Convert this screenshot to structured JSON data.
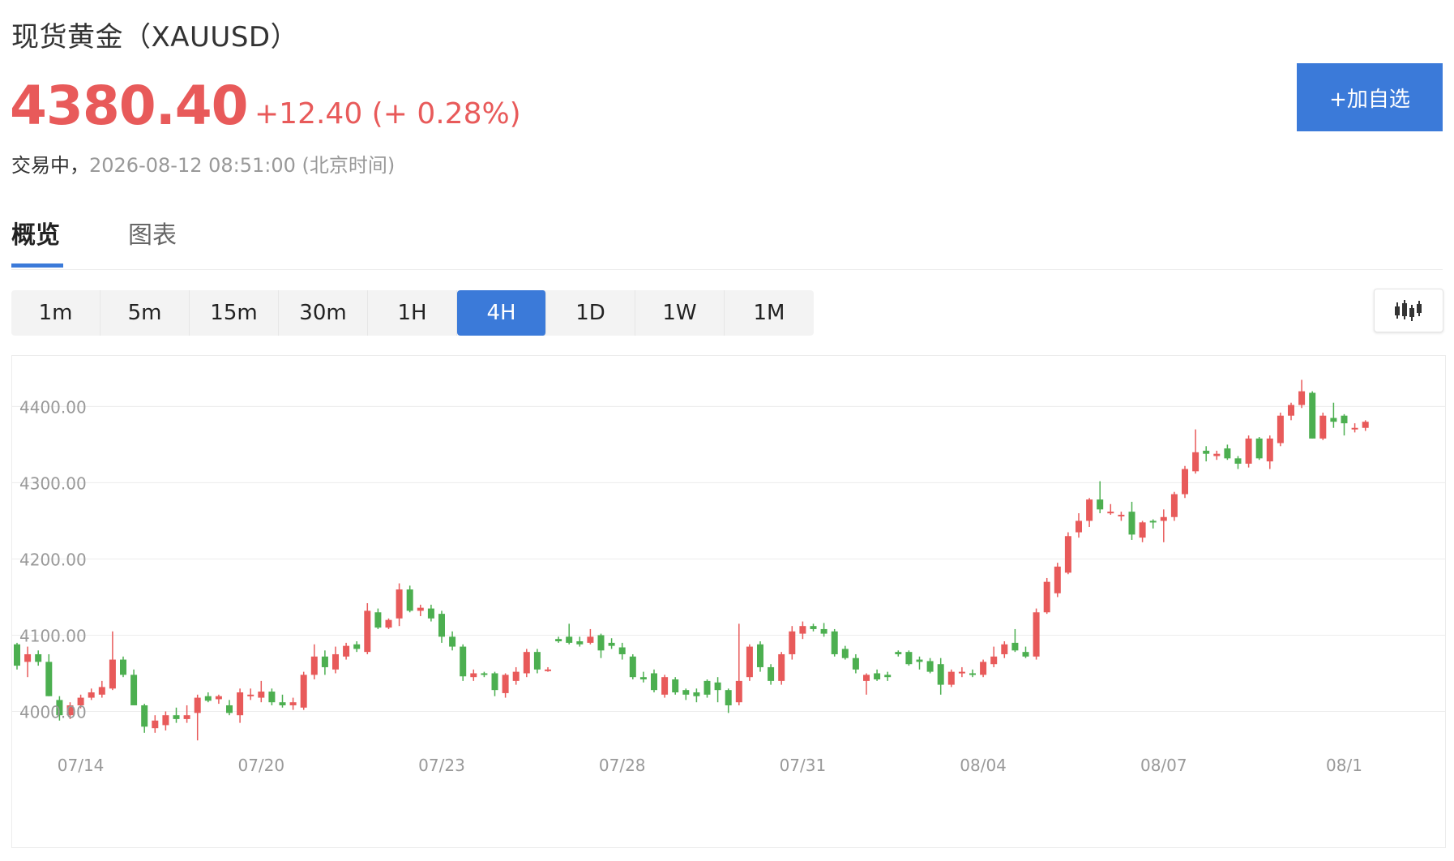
{
  "header": {
    "title": "现货黄金（XAUUSD）",
    "price": "4380.40",
    "change": "+12.40 (+ 0.28%)",
    "status": "交易中，",
    "time": "2026-08-12 08:51:00 (北京时间)",
    "watch_button": "+加自选"
  },
  "tabs": [
    {
      "label": "概览",
      "active": true
    },
    {
      "label": "图表",
      "active": false
    }
  ],
  "periods": [
    {
      "label": "1m",
      "active": false
    },
    {
      "label": "5m",
      "active": false
    },
    {
      "label": "15m",
      "active": false
    },
    {
      "label": "30m",
      "active": false
    },
    {
      "label": "1H",
      "active": false
    },
    {
      "label": "4H",
      "active": true
    },
    {
      "label": "1D",
      "active": false
    },
    {
      "label": "1W",
      "active": false
    },
    {
      "label": "1M",
      "active": false
    }
  ],
  "chart_type_icon": "candlestick-icon",
  "colors": {
    "up": "#e85a5a",
    "down": "#4caf50",
    "accent": "#3b7ad9"
  },
  "chart_data": {
    "type": "candlestick",
    "grid": true,
    "ylim": [
      3975,
      4460
    ],
    "y_ticks": [
      4000,
      4100,
      4200,
      4300,
      4400
    ],
    "y_tick_labels": [
      "4000.00",
      "4100.00",
      "4200.00",
      "4300.00",
      "4400.00"
    ],
    "x_ticks": [
      {
        "label": "07/14",
        "index": 6
      },
      {
        "label": "07/20",
        "index": 23
      },
      {
        "label": "07/23",
        "index": 40
      },
      {
        "label": "07/28",
        "index": 57
      },
      {
        "label": "07/31",
        "index": 74
      },
      {
        "label": "08/04",
        "index": 91
      },
      {
        "label": "08/07",
        "index": 108
      },
      {
        "label": "08/1",
        "index": 125
      }
    ],
    "candles": [
      [
        4088,
        4090,
        4055,
        4060
      ],
      [
        4065,
        4085,
        4045,
        4075
      ],
      [
        4075,
        4080,
        4060,
        4065
      ],
      [
        4065,
        4075,
        4020,
        4020
      ],
      [
        4015,
        4020,
        3988,
        3995
      ],
      [
        3995,
        4012,
        3990,
        4008
      ],
      [
        4008,
        4022,
        4004,
        4018
      ],
      [
        4018,
        4030,
        4015,
        4025
      ],
      [
        4022,
        4040,
        4018,
        4032
      ],
      [
        4030,
        4105,
        4028,
        4068
      ],
      [
        4068,
        4072,
        4045,
        4048
      ],
      [
        4048,
        4055,
        4008,
        4008
      ],
      [
        4008,
        4010,
        3972,
        3980
      ],
      [
        3978,
        3995,
        3972,
        3988
      ],
      [
        3982,
        4000,
        3975,
        3995
      ],
      [
        3995,
        4005,
        3985,
        3990
      ],
      [
        3990,
        4008,
        3985,
        3995
      ],
      [
        3998,
        4022,
        3962,
        4018
      ],
      [
        4020,
        4025,
        4012,
        4014
      ],
      [
        4016,
        4022,
        4010,
        4020
      ],
      [
        4008,
        4015,
        3995,
        3998
      ],
      [
        3995,
        4030,
        3985,
        4025
      ],
      [
        4022,
        4030,
        4015,
        4022
      ],
      [
        4018,
        4040,
        4012,
        4026
      ],
      [
        4026,
        4030,
        4008,
        4012
      ],
      [
        4012,
        4022,
        4005,
        4008
      ],
      [
        4008,
        4018,
        4002,
        4012
      ],
      [
        4005,
        4052,
        4002,
        4048
      ],
      [
        4048,
        4088,
        4042,
        4072
      ],
      [
        4072,
        4080,
        4048,
        4058
      ],
      [
        4055,
        4085,
        4050,
        4075
      ],
      [
        4072,
        4090,
        4068,
        4086
      ],
      [
        4088,
        4092,
        4078,
        4082
      ],
      [
        4078,
        4142,
        4075,
        4132
      ],
      [
        4130,
        4135,
        4108,
        4110
      ],
      [
        4110,
        4122,
        4108,
        4120
      ],
      [
        4122,
        4168,
        4112,
        4160
      ],
      [
        4160,
        4165,
        4130,
        4132
      ],
      [
        4132,
        4140,
        4125,
        4136
      ],
      [
        4135,
        4140,
        4118,
        4122
      ],
      [
        4128,
        4132,
        4090,
        4098
      ],
      [
        4098,
        4105,
        4080,
        4085
      ],
      [
        4085,
        4088,
        4040,
        4046
      ],
      [
        4045,
        4055,
        4040,
        4050
      ],
      [
        4050,
        4052,
        4045,
        4048
      ],
      [
        4050,
        4052,
        4020,
        4028
      ],
      [
        4024,
        4050,
        4018,
        4048
      ],
      [
        4040,
        4058,
        4035,
        4052
      ],
      [
        4050,
        4082,
        4045,
        4078
      ],
      [
        4078,
        4082,
        4050,
        4055
      ],
      [
        4055,
        4058,
        4052,
        4055
      ],
      [
        4095,
        4098,
        4090,
        4092
      ],
      [
        4098,
        4115,
        4088,
        4090
      ],
      [
        4092,
        4098,
        4085,
        4088
      ],
      [
        4090,
        4108,
        4088,
        4098
      ],
      [
        4100,
        4102,
        4070,
        4080
      ],
      [
        4090,
        4096,
        4082,
        4086
      ],
      [
        4084,
        4090,
        4068,
        4075
      ],
      [
        4072,
        4075,
        4042,
        4045
      ],
      [
        4045,
        4052,
        4038,
        4042
      ],
      [
        4050,
        4055,
        4025,
        4028
      ],
      [
        4022,
        4048,
        4018,
        4045
      ],
      [
        4042,
        4045,
        4022,
        4025
      ],
      [
        4028,
        4030,
        4015,
        4022
      ],
      [
        4025,
        4030,
        4012,
        4020
      ],
      [
        4040,
        4042,
        4018,
        4022
      ],
      [
        4038,
        4045,
        4012,
        4028
      ],
      [
        4028,
        4030,
        3998,
        4008
      ],
      [
        4012,
        4115,
        4008,
        4040
      ],
      [
        4045,
        4088,
        4040,
        4085
      ],
      [
        4088,
        4092,
        4052,
        4058
      ],
      [
        4058,
        4062,
        4035,
        4040
      ],
      [
        4040,
        4078,
        4035,
        4075
      ],
      [
        4075,
        4112,
        4068,
        4105
      ],
      [
        4102,
        4118,
        4095,
        4112
      ],
      [
        4112,
        4115,
        4105,
        4108
      ],
      [
        4108,
        4116,
        4098,
        4102
      ],
      [
        4105,
        4108,
        4072,
        4075
      ],
      [
        4082,
        4086,
        4068,
        4070
      ],
      [
        4070,
        4075,
        4050,
        4055
      ],
      [
        4040,
        4050,
        4022,
        4048
      ],
      [
        4050,
        4055,
        4040,
        4042
      ],
      [
        4048,
        4052,
        4040,
        4045
      ],
      [
        4078,
        4080,
        4072,
        4075
      ],
      [
        4078,
        4080,
        4060,
        4062
      ],
      [
        4068,
        4072,
        4055,
        4065
      ],
      [
        4066,
        4070,
        4050,
        4052
      ],
      [
        4062,
        4070,
        4022,
        4035
      ],
      [
        4035,
        4055,
        4032,
        4052
      ],
      [
        4050,
        4058,
        4045,
        4052
      ],
      [
        4050,
        4055,
        4045,
        4048
      ],
      [
        4048,
        4068,
        4045,
        4065
      ],
      [
        4062,
        4085,
        4058,
        4072
      ],
      [
        4075,
        4092,
        4070,
        4088
      ],
      [
        4090,
        4108,
        4078,
        4080
      ],
      [
        4078,
        4085,
        4070,
        4072
      ],
      [
        4072,
        4135,
        4068,
        4130
      ],
      [
        4130,
        4175,
        4128,
        4170
      ],
      [
        4155,
        4195,
        4150,
        4190
      ],
      [
        4182,
        4235,
        4180,
        4230
      ],
      [
        4235,
        4260,
        4228,
        4250
      ],
      [
        4250,
        4280,
        4242,
        4278
      ],
      [
        4278,
        4302,
        4260,
        4265
      ],
      [
        4262,
        4272,
        4258,
        4262
      ],
      [
        4258,
        4262,
        4250,
        4258
      ],
      [
        4262,
        4275,
        4225,
        4232
      ],
      [
        4228,
        4250,
        4222,
        4248
      ],
      [
        4250,
        4252,
        4240,
        4248
      ],
      [
        4250,
        4265,
        4222,
        4255
      ],
      [
        4255,
        4288,
        4250,
        4285
      ],
      [
        4285,
        4322,
        4280,
        4318
      ],
      [
        4315,
        4370,
        4312,
        4340
      ],
      [
        4342,
        4348,
        4328,
        4338
      ],
      [
        4335,
        4342,
        4330,
        4338
      ],
      [
        4345,
        4350,
        4330,
        4332
      ],
      [
        4332,
        4335,
        4318,
        4325
      ],
      [
        4325,
        4362,
        4320,
        4358
      ],
      [
        4358,
        4360,
        4330,
        4332
      ],
      [
        4328,
        4362,
        4318,
        4358
      ],
      [
        4352,
        4392,
        4348,
        4388
      ],
      [
        4388,
        4405,
        4382,
        4402
      ],
      [
        4402,
        4435,
        4398,
        4420
      ],
      [
        4418,
        4420,
        4358,
        4358
      ],
      [
        4358,
        4392,
        4356,
        4388
      ],
      [
        4385,
        4405,
        4372,
        4380
      ],
      [
        4388,
        4390,
        4362,
        4378
      ],
      [
        4370,
        4378,
        4366,
        4372
      ],
      [
        4372,
        4382,
        4368,
        4380
      ]
    ]
  }
}
